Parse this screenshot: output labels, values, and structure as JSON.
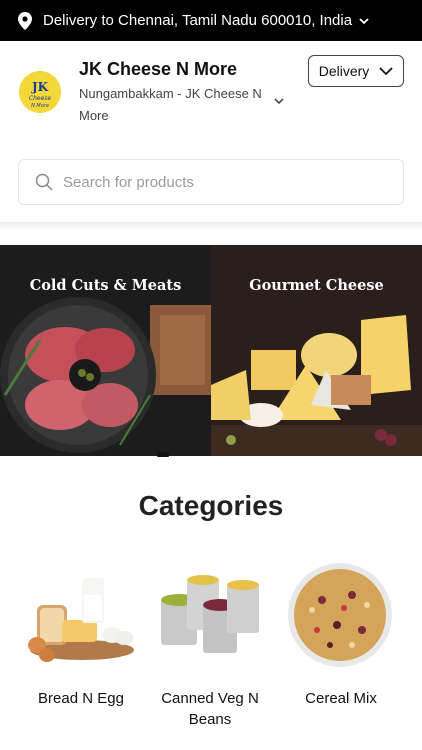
{
  "topbar": {
    "location_text": "Delivery to Chennai, Tamil Nadu 600010, India",
    "pin_icon": "location-pin-icon",
    "chevron_icon": "chevron-down-icon"
  },
  "store": {
    "name": "JK Cheese N More",
    "location": "Nungambakkam - JK Cheese N More",
    "logo_text_1": "JK",
    "logo_text_2": "Cheese N More",
    "mode_button": "Delivery"
  },
  "search": {
    "placeholder": "Search for products"
  },
  "banners": [
    {
      "title": "Cold Cuts & Meats"
    },
    {
      "title": "Gourmet Cheese"
    }
  ],
  "categories": {
    "title": "Categories",
    "items": [
      {
        "label": "Bread N Egg"
      },
      {
        "label": "Canned Veg N Beans"
      },
      {
        "label": "Cereal Mix"
      }
    ]
  },
  "colors": {
    "topbar_bg": "#000000",
    "logo_bg": "#f4d83a",
    "text": "#111111"
  }
}
